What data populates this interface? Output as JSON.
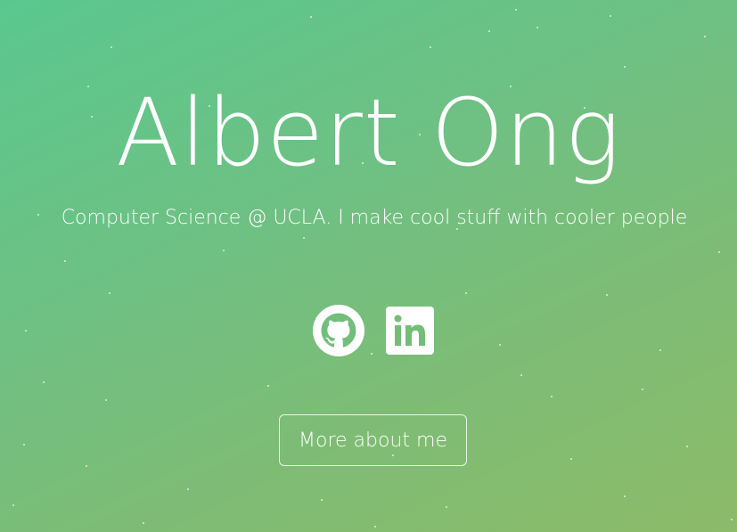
{
  "hero": {
    "name": "Albert Ong",
    "tagline": "Computer Science @ UCLA. I make cool stuff with cooler people",
    "socials": [
      {
        "icon": "github-icon",
        "label": "GitHub"
      },
      {
        "icon": "linkedin-icon",
        "label": "LinkedIn"
      }
    ],
    "button_label": "More about me"
  },
  "colors": {
    "gradient_start": "#5ac88e",
    "gradient_end": "#8cbb69",
    "text": "#ffffff"
  }
}
